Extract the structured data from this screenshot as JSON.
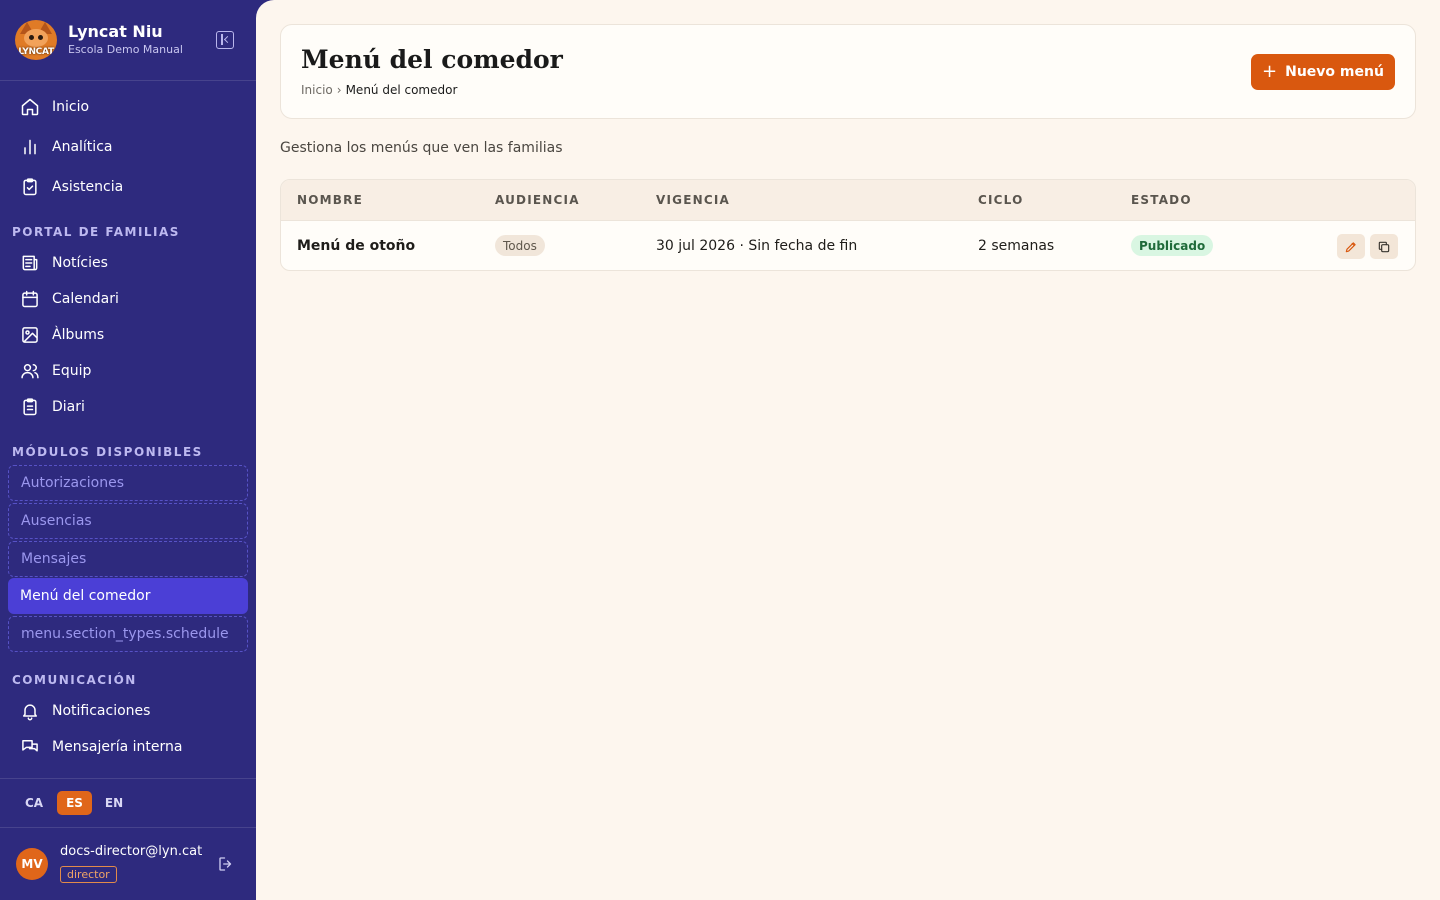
{
  "brand": {
    "logo_text": "LYNCAT",
    "name": "Lyncat Niu",
    "school": "Escola Demo Manual"
  },
  "nav": {
    "main": [
      {
        "label": "Inicio",
        "icon": "home-icon"
      },
      {
        "label": "Analítica",
        "icon": "bar-chart-icon"
      },
      {
        "label": "Asistencia",
        "icon": "clipboard-check-icon"
      }
    ],
    "portal_title": "PORTAL DE FAMILIAS",
    "portal": [
      {
        "label": "Notícies",
        "icon": "newspaper-icon"
      },
      {
        "label": "Calendari",
        "icon": "calendar-icon"
      },
      {
        "label": "Àlbums",
        "icon": "image-icon"
      },
      {
        "label": "Equip",
        "icon": "users-icon"
      },
      {
        "label": "Diari",
        "icon": "clipboard-list-icon"
      }
    ],
    "modules_title": "MÓDULOS DISPONIBLES",
    "modules": [
      {
        "label": "Autorizaciones",
        "active": false
      },
      {
        "label": "Ausencias",
        "active": false
      },
      {
        "label": "Mensajes",
        "active": false
      },
      {
        "label": "Menú del comedor",
        "active": true
      },
      {
        "label": "menu.section_types.schedule",
        "active": false
      }
    ],
    "comms_title": "COMUNICACIÓN",
    "comms": [
      {
        "label": "Notificaciones",
        "icon": "bell-icon"
      },
      {
        "label": "Mensajería interna",
        "icon": "chat-icon"
      }
    ]
  },
  "languages": [
    {
      "code": "CA",
      "active": false
    },
    {
      "code": "ES",
      "active": true
    },
    {
      "code": "EN",
      "active": false
    }
  ],
  "user": {
    "initials": "MV",
    "email": "docs-director@lyn.cat",
    "role": "director"
  },
  "header": {
    "title": "Menú del comedor",
    "breadcrumb_home": "Inicio",
    "breadcrumb_sep": "›",
    "breadcrumb_current": "Menú del comedor",
    "new_button": "Nuevo menú"
  },
  "subtitle": "Gestiona los menús que ven las familias",
  "table": {
    "columns": [
      "NOMBRE",
      "AUDIENCIA",
      "VIGENCIA",
      "CICLO",
      "ESTADO"
    ],
    "rows": [
      {
        "name": "Menú de otoño",
        "audience": "Todos",
        "validity": "30 jul 2026 · Sin fecha de fin",
        "cycle": "2 semanas",
        "status": "Publicado"
      }
    ]
  },
  "colors": {
    "sidebar": "#2e2a7e",
    "accent": "#d9580f",
    "active_module": "#4b3fd6",
    "published": "#d9f6e2"
  }
}
